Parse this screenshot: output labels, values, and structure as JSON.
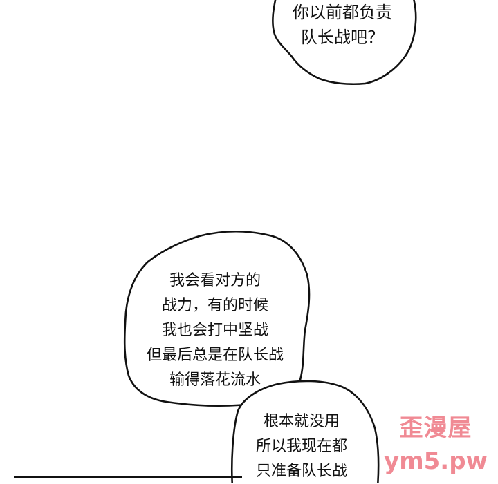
{
  "panel": {
    "bubbles": [
      {
        "lines": [
          "你以前都负责",
          "队长战吧？"
        ]
      },
      {
        "lines": [
          "我会看对方的",
          "战力，有的时候",
          "我也会打中坚战",
          "但最后总是在队长战",
          "输得落花流水"
        ]
      },
      {
        "lines": [
          "根本就没用",
          "所以我现在都",
          "只准备队长战"
        ]
      }
    ]
  },
  "watermark": {
    "line1": "歪漫屋",
    "line2": "ym5.pw",
    "color": "#f08a94"
  }
}
